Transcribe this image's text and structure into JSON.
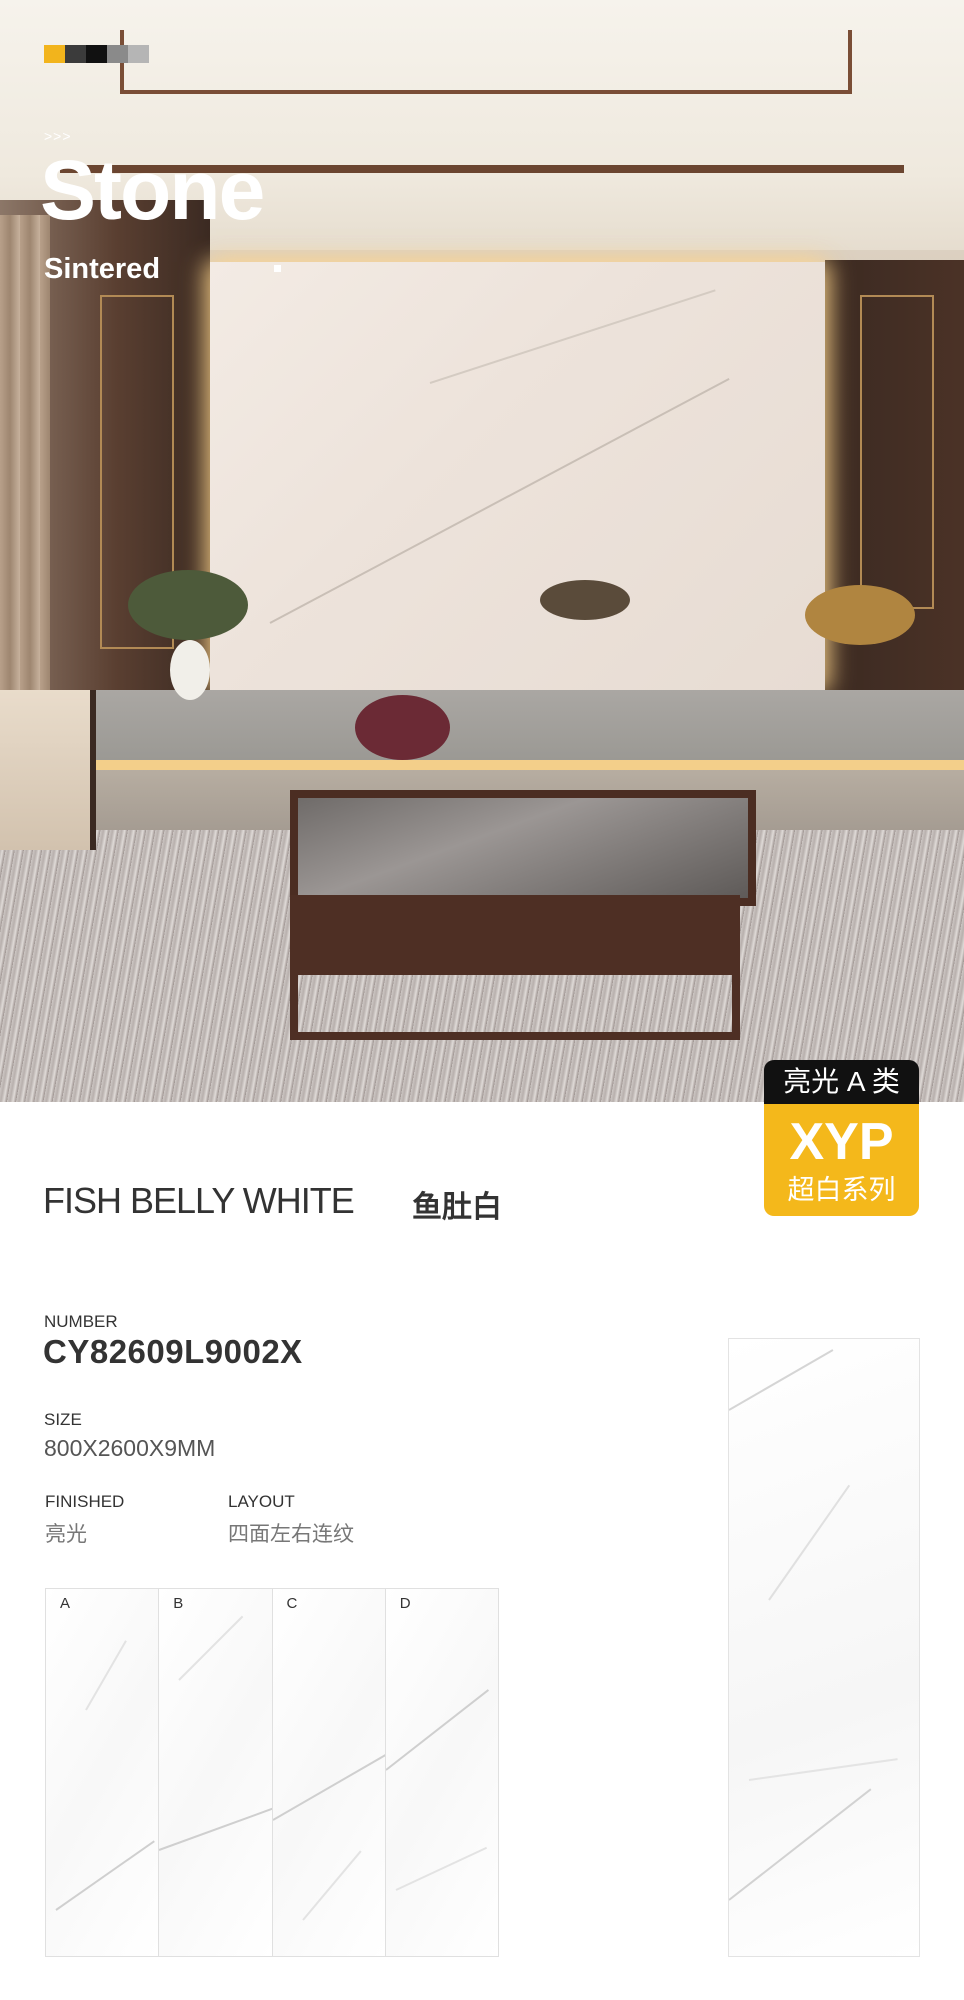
{
  "hero": {
    "arrows": ">>>",
    "title": "Stone",
    "subtitle": "Sintered",
    "swatch_colors": [
      "#f2b41c",
      "#3b3b3b",
      "#111111",
      "#8a8a8a",
      "#b5b5b5"
    ]
  },
  "badge": {
    "top": "亮光 A 类",
    "brand": "XYP",
    "series": "超白系列",
    "accent_color": "#f4b81b"
  },
  "product": {
    "name_en": "FISH BELLY WHITE",
    "name_cn": "鱼肚白",
    "number_label": "NUMBER",
    "number_value": "CY82609L9002X",
    "size_label": "SIZE",
    "size_value": "800X2600X9MM",
    "finished_label": "FINISHED",
    "finished_value": "亮光",
    "layout_label": "LAYOUT",
    "layout_value": "四面左右连纹"
  },
  "layout_tiles": [
    "A",
    "B",
    "C",
    "D"
  ]
}
